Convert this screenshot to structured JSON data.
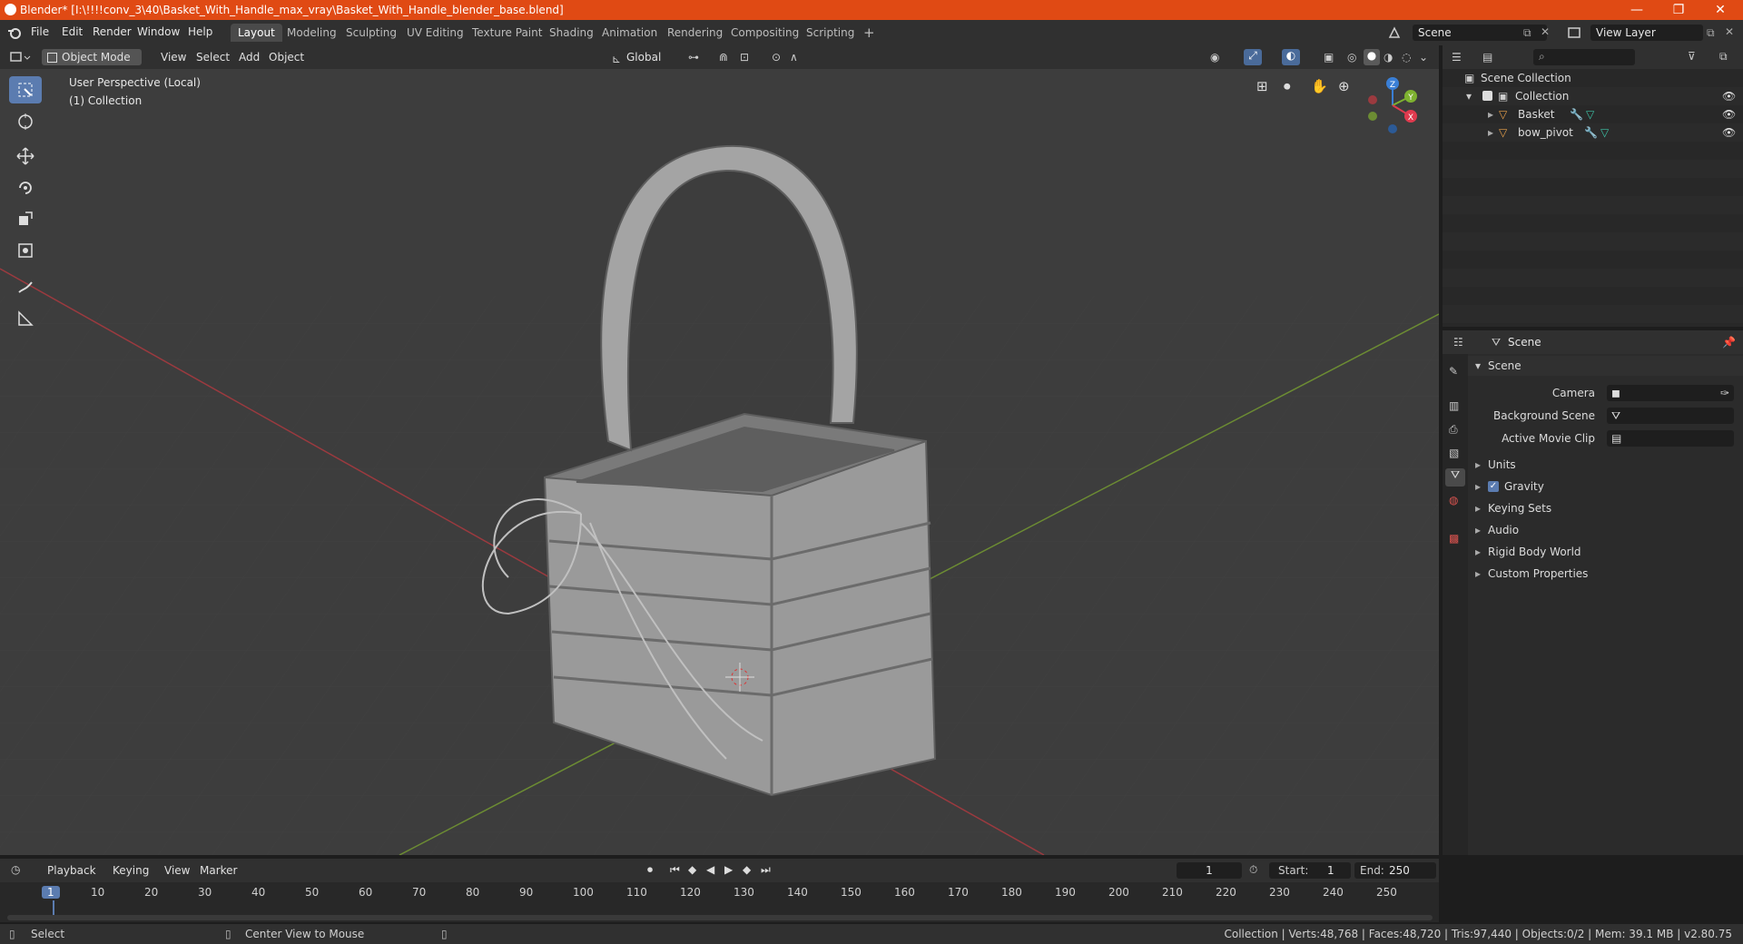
{
  "window": {
    "title": "Blender* [I:\\!!!!conv_3\\40\\Basket_With_Handle_max_vray\\Basket_With_Handle_blender_base.blend]",
    "minimize": "—",
    "maximize": "❐",
    "close": "✕"
  },
  "menu": [
    "File",
    "Edit",
    "Render",
    "Window",
    "Help"
  ],
  "workspaces": [
    "Layout",
    "Modeling",
    "Sculpting",
    "UV Editing",
    "Texture Paint",
    "Shading",
    "Animation",
    "Rendering",
    "Compositing",
    "Scripting"
  ],
  "workspace_add": "+",
  "scene": {
    "label": "Scene"
  },
  "view_layer": {
    "label": "View Layer"
  },
  "viewport_header": {
    "mode": "Object Mode",
    "items": [
      "View",
      "Select",
      "Add",
      "Object"
    ],
    "transform": "Global"
  },
  "viewport": {
    "perspective": "User Perspective (Local)",
    "collection": "(1) Collection",
    "axis_x": "X",
    "axis_y": "Y",
    "axis_z": "Z"
  },
  "outliner": {
    "root": "Scene Collection",
    "collection": "Collection",
    "objects": [
      "Basket",
      "bow_pivot"
    ]
  },
  "properties": {
    "header": "Scene",
    "section": "Scene",
    "fields": [
      {
        "label": "Camera"
      },
      {
        "label": "Background Scene"
      },
      {
        "label": "Active Movie Clip"
      }
    ],
    "panels": [
      "Units",
      "Gravity",
      "Keying Sets",
      "Audio",
      "Rigid Body World",
      "Custom Properties"
    ]
  },
  "timeline": {
    "menus": [
      "Playback",
      "Keying",
      "View",
      "Marker"
    ],
    "current_frame": "1",
    "start_label": "Start:",
    "start": "1",
    "end_label": "End:",
    "end": "250",
    "ticks": [
      "1",
      "10",
      "20",
      "30",
      "40",
      "50",
      "60",
      "70",
      "80",
      "90",
      "100",
      "110",
      "120",
      "130",
      "140",
      "150",
      "160",
      "170",
      "180",
      "190",
      "200",
      "210",
      "220",
      "230",
      "240",
      "250"
    ]
  },
  "status": {
    "left": "Select",
    "middle": "Center View to Mouse",
    "right": "Collection | Verts:48,768 | Faces:48,720 | Tris:97,440 | Objects:0/2 | Mem: 39.1 MB | v2.80.75"
  },
  "colors": {
    "titlebar": "#e04a14",
    "accent": "#5b7cb0",
    "axis_x": "#e03a4e",
    "axis_y": "#7eb230",
    "axis_z": "#3a7fd6"
  }
}
